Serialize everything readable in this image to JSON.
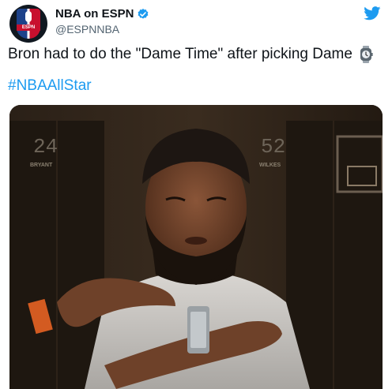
{
  "account": {
    "name": "NBA on ESPN",
    "handle": "@ESPNNBA",
    "avatar_text": "ESPN",
    "verified": true
  },
  "tweet": {
    "text": "Bron had to do the \"Dame Time\" after picking Dame",
    "emoji": "watch-icon",
    "hashtag": "#NBAAllStar"
  },
  "media": {
    "jersey_left_number": "24",
    "jersey_left_name": "BRYANT",
    "jersey_right_number": "52",
    "jersey_right_name": "WILKES"
  },
  "colors": {
    "twitter_blue": "#1d9bf0",
    "text": "#0f1419",
    "secondary": "#536471"
  }
}
